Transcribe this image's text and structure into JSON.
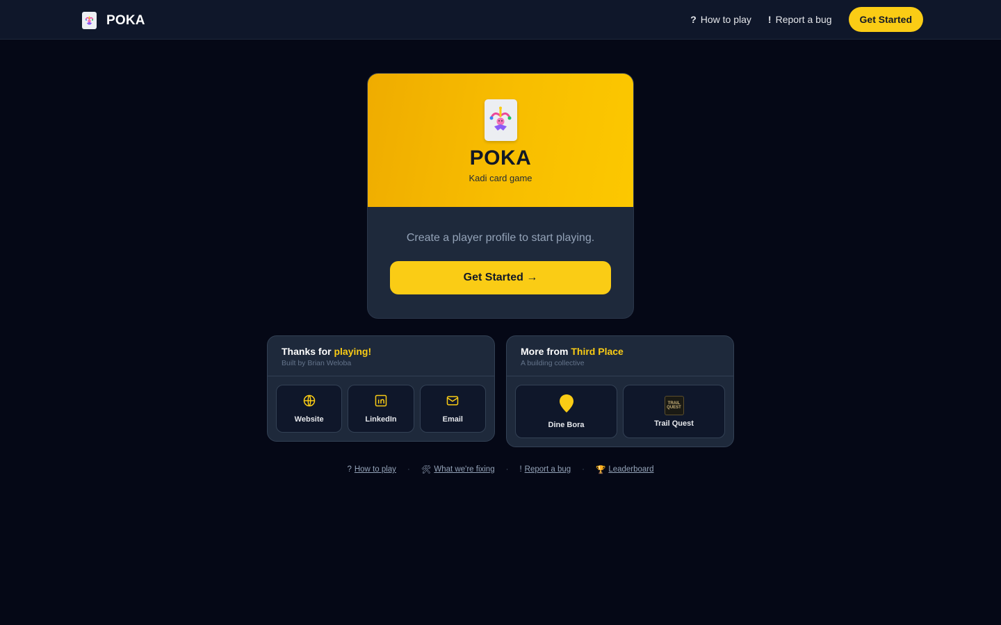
{
  "header": {
    "brand": "POKA",
    "nav": [
      {
        "glyph": "?",
        "label": "How to play"
      },
      {
        "glyph": "!",
        "label": "Report a bug"
      }
    ],
    "cta_label": "Get Started"
  },
  "hero": {
    "title": "POKA",
    "subtitle": "Kadi card game",
    "prompt": "Create a player profile to start playing.",
    "cta_label": "Get Started →"
  },
  "thanks": {
    "title_prefix": "Thanks for ",
    "title_accent": "playing!",
    "subtitle": "Built by Brian Weloba",
    "links": [
      {
        "icon": "globe-icon",
        "label": "Website"
      },
      {
        "icon": "linkedin-icon",
        "label": "LinkedIn"
      },
      {
        "icon": "mail-icon",
        "label": "Email"
      }
    ]
  },
  "more": {
    "title_prefix": "More from ",
    "title_accent": "Third Place",
    "subtitle": "A building collective",
    "apps": [
      {
        "icon": "map-pin-icon",
        "label": "Dine Bora"
      },
      {
        "icon": "trail-quest-logo",
        "label": "Trail Quest",
        "logo_text": "TRAIL QUEST"
      }
    ]
  },
  "footer": {
    "links": [
      {
        "glyph": "?",
        "label": "How to play"
      },
      {
        "glyph": "🛠",
        "label": "What we're fixing"
      },
      {
        "glyph": "!",
        "label": "Report a bug"
      },
      {
        "glyph": "🏆",
        "label": "Leaderboard"
      }
    ],
    "separator": "·"
  },
  "colors": {
    "accent": "#facc15",
    "background": "#050816",
    "surface": "#1e293b",
    "muted": "#94a3b8"
  }
}
